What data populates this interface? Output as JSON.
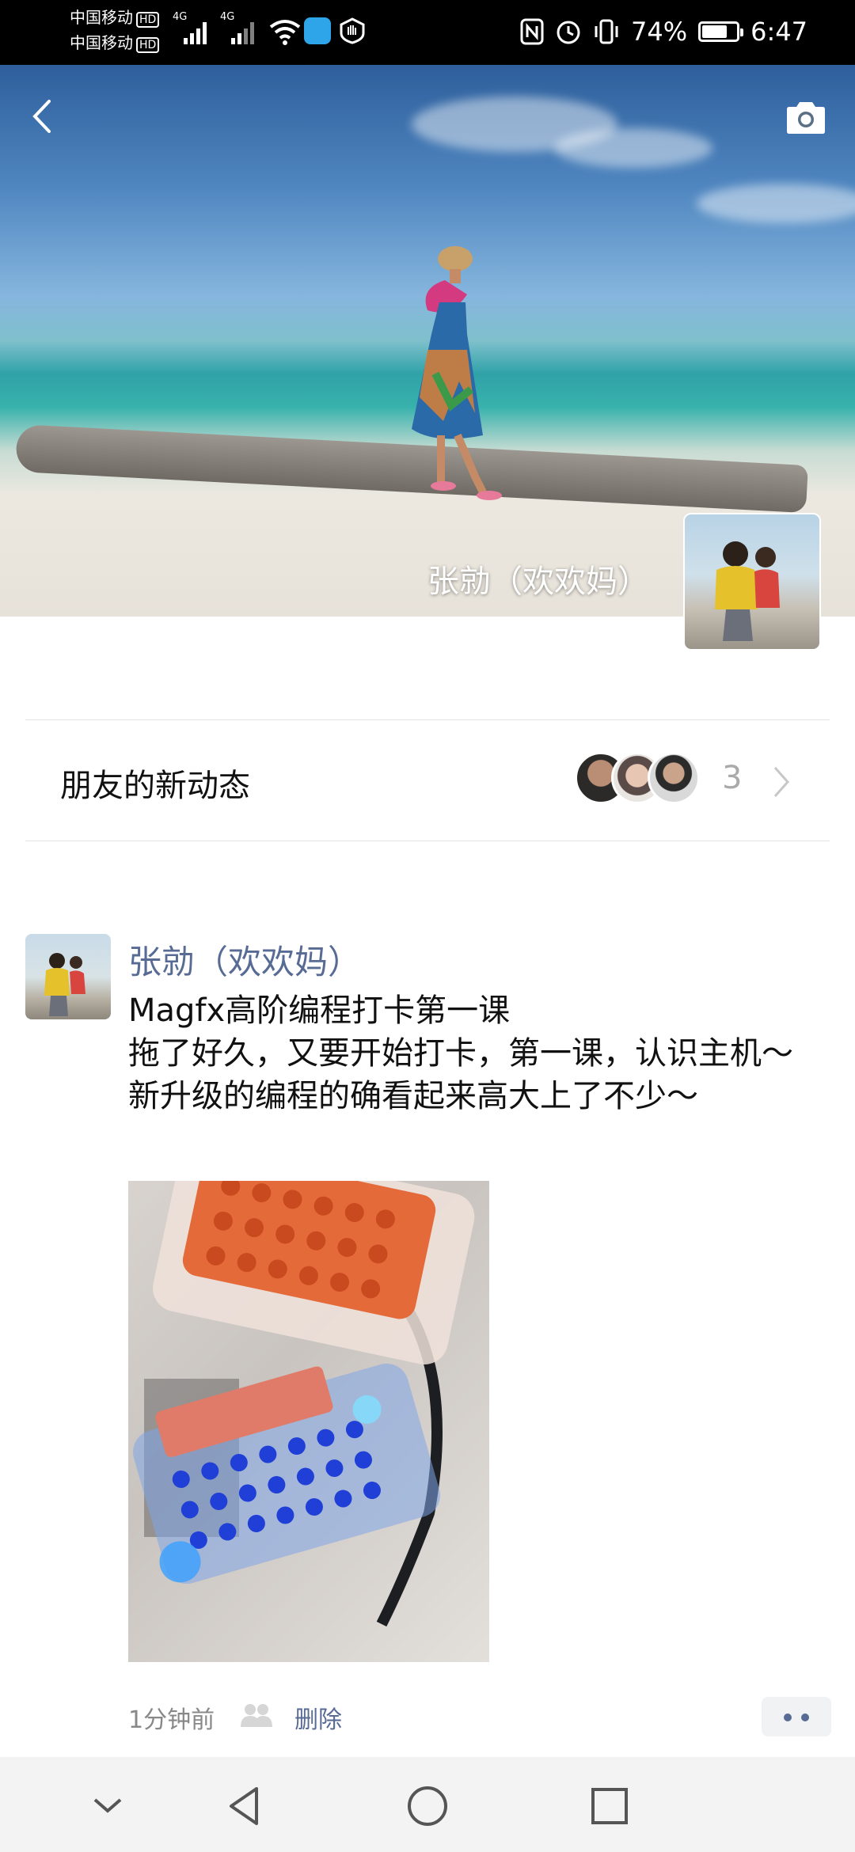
{
  "status_bar": {
    "carrier_1": "中国移动",
    "carrier_2": "中国移动",
    "hd_label": "HD",
    "network_type": "4G",
    "battery_text": "74%",
    "battery_level": 0.74,
    "time": "6:47"
  },
  "cover": {
    "user_name": "张勍（欢欢妈）",
    "back_icon": "chevron-left-icon",
    "camera_icon": "camera-icon"
  },
  "friend_updates": {
    "label": "朋友的新动态",
    "count": "3"
  },
  "post": {
    "author": "张勍（欢欢妈）",
    "text": "Magfx高阶编程打卡第一课\n拖了好久，又要开始打卡，第一课，认识主机～新升级的编程的确看起来高大上了不少～",
    "time_ago": "1分钟前",
    "delete_label": "删除"
  },
  "nav_bar": {
    "icons": [
      "chevron-down-icon",
      "back-triangle-icon",
      "home-circle-icon",
      "recents-square-icon"
    ]
  },
  "colors": {
    "link": "#576b95",
    "status_bg": "#000000",
    "nav_bg": "#f3f3f3"
  }
}
